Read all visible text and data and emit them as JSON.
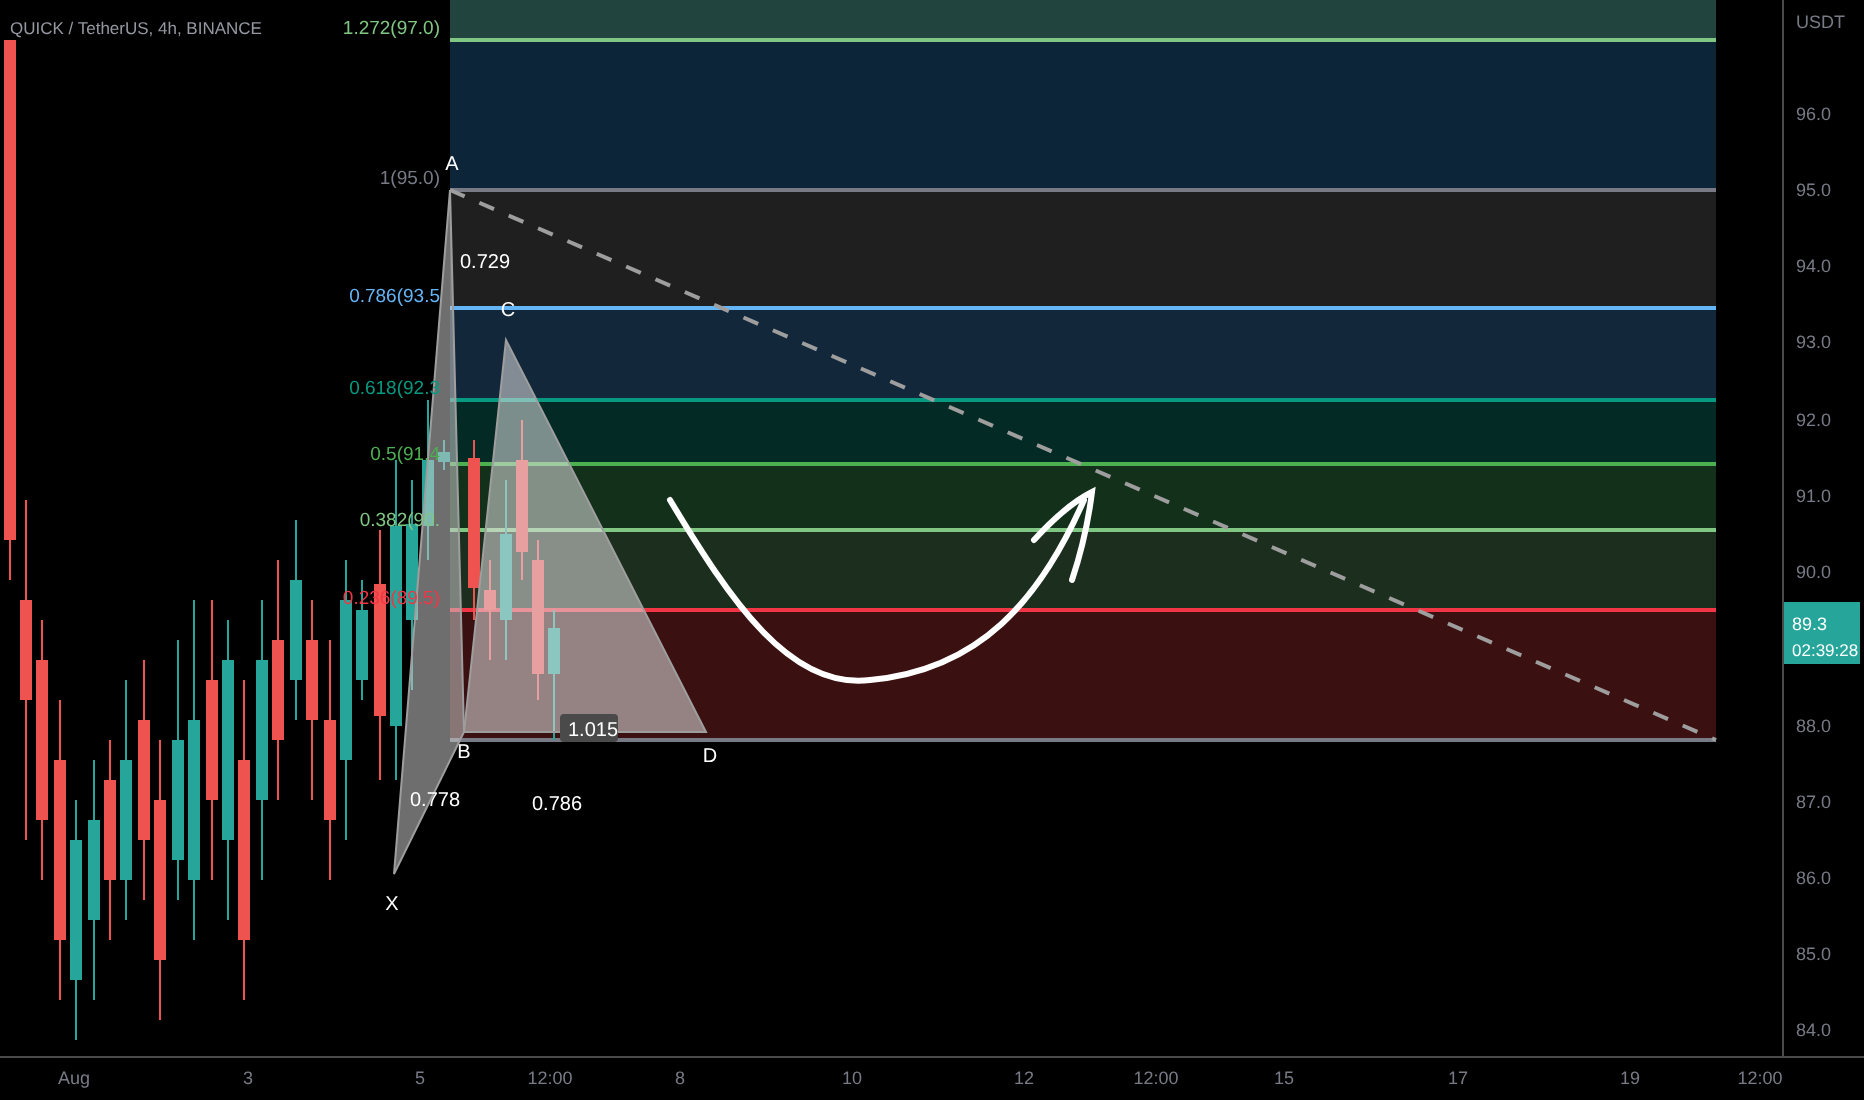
{
  "header": {
    "title": "QUICK / TetherUS, 4h, BINANCE"
  },
  "price_axis": {
    "unit": "USDT",
    "ticks": [
      "96.0",
      "95.0",
      "94.0",
      "93.0",
      "92.0",
      "91.0",
      "90.0",
      "88.0",
      "87.0",
      "86.0",
      "85.0",
      "84.0"
    ],
    "last_price": "89.3",
    "countdown": "02:39:28"
  },
  "time_axis": {
    "ticks": [
      "Aug",
      "3",
      "5",
      "12:00",
      "8",
      "10",
      "12",
      "12:00",
      "15",
      "17",
      "19",
      "12:00"
    ]
  },
  "fib_levels": [
    {
      "label": "1.272(97.0)",
      "color": "#81c784"
    },
    {
      "label": "1(95.0)",
      "color": "#787b86"
    },
    {
      "label": "0.786(93.5",
      "color": "#64b5f6"
    },
    {
      "label": "0.618(92.3",
      "color": "#089981"
    },
    {
      "label": "0.5(91.4",
      "color": "#4caf50"
    },
    {
      "label": "0.382(90.",
      "color": "#81c784"
    },
    {
      "label": "0.236(89.5)",
      "color": "#f23645"
    }
  ],
  "pattern": {
    "points": [
      "X",
      "A",
      "B",
      "C",
      "D"
    ],
    "ratios": [
      "0.729",
      "0.778",
      "0.786",
      "1.015"
    ]
  }
}
